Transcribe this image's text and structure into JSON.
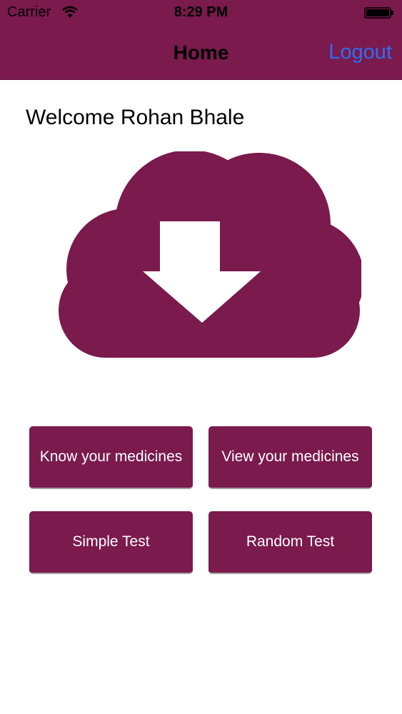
{
  "status_bar": {
    "carrier": "Carrier",
    "time": "8:29 PM",
    "wifi_icon": "wifi-icon",
    "battery_icon": "battery-full-icon"
  },
  "nav": {
    "title": "Home",
    "logout_label": "Logout"
  },
  "welcome_text": "Welcome Rohan Bhale",
  "hero_icon": "cloud-download-icon",
  "buttons": [
    {
      "label": "Know your medicines"
    },
    {
      "label": "View your medicines"
    },
    {
      "label": "Simple Test"
    },
    {
      "label": "Random Test"
    }
  ],
  "colors": {
    "brand": "#7a1a4d",
    "link": "#2f6df2",
    "background": "#ffffff"
  }
}
